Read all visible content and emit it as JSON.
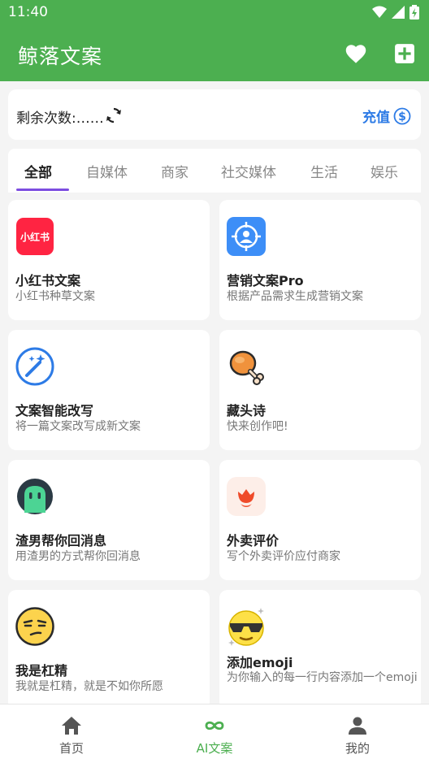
{
  "status": {
    "time": "11:40"
  },
  "app": {
    "title": "鲸落文案",
    "icons": [
      "heart-icon",
      "add-square-icon"
    ]
  },
  "quota": {
    "label": "剩余次数:……",
    "refresh_icon": "refresh-icon",
    "recharge_label": "充值",
    "recharge_icon": "dollar-circle-icon",
    "accent": "#2d7be6"
  },
  "tabs": [
    {
      "label": "全部",
      "active": true
    },
    {
      "label": "自媒体"
    },
    {
      "label": "商家"
    },
    {
      "label": "社交媒体"
    },
    {
      "label": "生活"
    },
    {
      "label": "娱乐"
    }
  ],
  "cards": [
    {
      "name": "小红书文案",
      "desc": "小红书种草文案",
      "icon": "xiaohongshu-icon",
      "icon_text": "小红书"
    },
    {
      "name": "营销文案Pro",
      "desc": "根据产品需求生成营销文案",
      "icon": "target-person-icon"
    },
    {
      "name": "文案智能改写",
      "desc": "将一篇文案改写成新文案",
      "icon": "magic-wand-icon"
    },
    {
      "name": "藏头诗",
      "desc": "快来创作吧!",
      "icon": "chicken-leg-icon"
    },
    {
      "name": "渣男帮你回消息",
      "desc": "用渣男的方式帮你回消息",
      "icon": "green-blob-icon"
    },
    {
      "name": "外卖评价",
      "desc": "写个外卖评价应付商家",
      "icon": "flower-icon"
    },
    {
      "name": "我是杠精",
      "desc": "我就是杠精，就是不如你所愿",
      "icon": "smirk-face-icon"
    },
    {
      "name": "添加emoji",
      "desc": "为你输入的每一行内容添加一个emoji",
      "icon": "sunglasses-face-icon"
    }
  ],
  "nav": [
    {
      "label": "首页",
      "icon": "home-icon"
    },
    {
      "label": "AI文案",
      "icon": "infinity-icon",
      "active": true
    },
    {
      "label": "我的",
      "icon": "person-icon"
    }
  ],
  "colors": {
    "primary": "#4caf50",
    "tab_indicator": "#7d4de0"
  }
}
